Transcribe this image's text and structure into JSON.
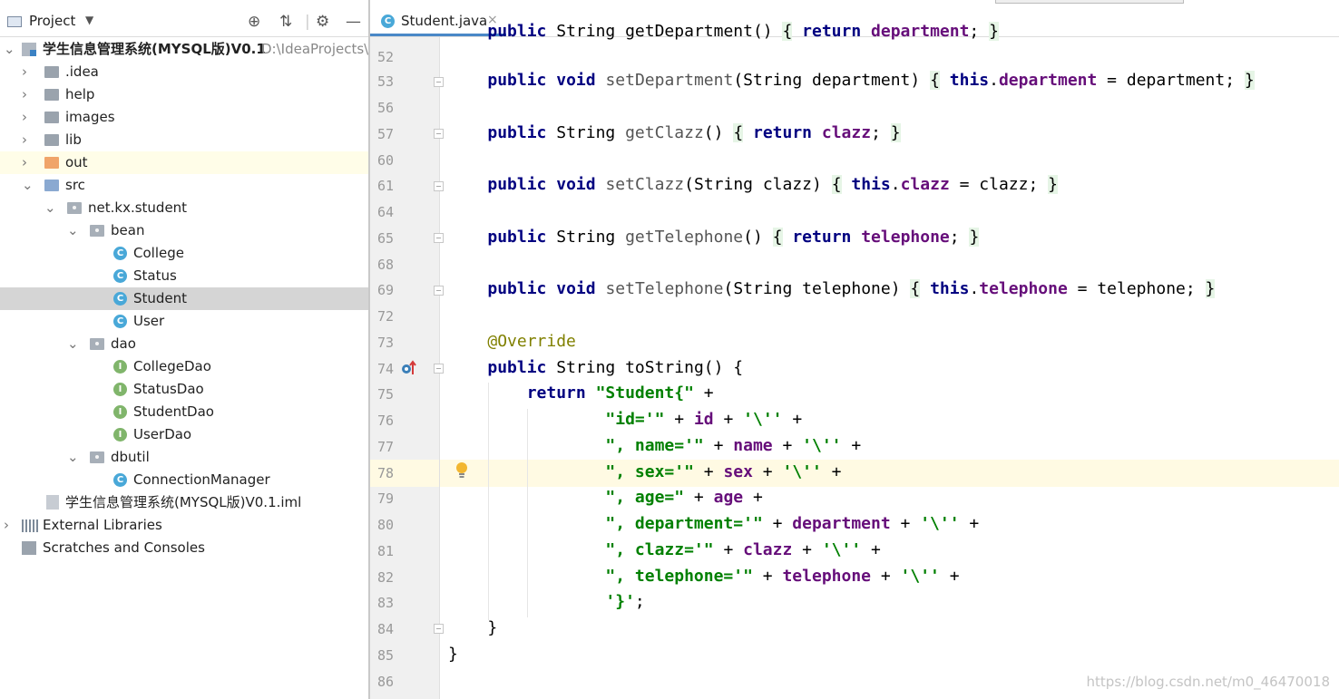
{
  "project_panel": {
    "title": "Project",
    "tree": [
      {
        "label": "学生信息管理系统(MYSQL版)V0.1",
        "path": "D:\\IdeaProjects\\",
        "icon": "module-icon",
        "bold": true
      },
      {
        "label": ".idea",
        "icon": "folder-icon"
      },
      {
        "label": "help",
        "icon": "folder-icon"
      },
      {
        "label": "images",
        "icon": "folder-icon"
      },
      {
        "label": "lib",
        "icon": "folder-icon"
      },
      {
        "label": "out",
        "icon": "folder-orange-icon"
      },
      {
        "label": "src",
        "icon": "source-folder-icon"
      },
      {
        "label": "net.kx.student",
        "icon": "package-icon"
      },
      {
        "label": "bean",
        "icon": "package-icon"
      },
      {
        "label": "College",
        "icon": "class-icon"
      },
      {
        "label": "Status",
        "icon": "class-icon"
      },
      {
        "label": "Student",
        "icon": "class-icon"
      },
      {
        "label": "User",
        "icon": "class-icon"
      },
      {
        "label": "dao",
        "icon": "package-icon"
      },
      {
        "label": "CollegeDao",
        "icon": "interface-icon"
      },
      {
        "label": "StatusDao",
        "icon": "interface-icon"
      },
      {
        "label": "StudentDao",
        "icon": "interface-icon"
      },
      {
        "label": "UserDao",
        "icon": "interface-icon"
      },
      {
        "label": "dbutil",
        "icon": "package-icon"
      },
      {
        "label": "ConnectionManager",
        "icon": "class-icon"
      },
      {
        "label": "学生信息管理系统(MYSQL版)V0.1.iml",
        "icon": "iml-file-icon"
      },
      {
        "label": "External Libraries",
        "icon": "libraries-icon"
      },
      {
        "label": "Scratches and Consoles",
        "icon": "scratches-icon"
      }
    ]
  },
  "editor": {
    "tab_label": "Student.java",
    "tab_close": "×",
    "line_numbers": [
      "52",
      "53",
      "56",
      "57",
      "60",
      "61",
      "64",
      "65",
      "68",
      "69",
      "72",
      "73",
      "74",
      "75",
      "76",
      "77",
      "78",
      "79",
      "80",
      "81",
      "82",
      "83",
      "84",
      "85",
      "86"
    ]
  },
  "icons": {
    "class_letter": "C",
    "interface_letter": "I"
  },
  "watermark": "https://blog.csdn.net/m0_46470018"
}
